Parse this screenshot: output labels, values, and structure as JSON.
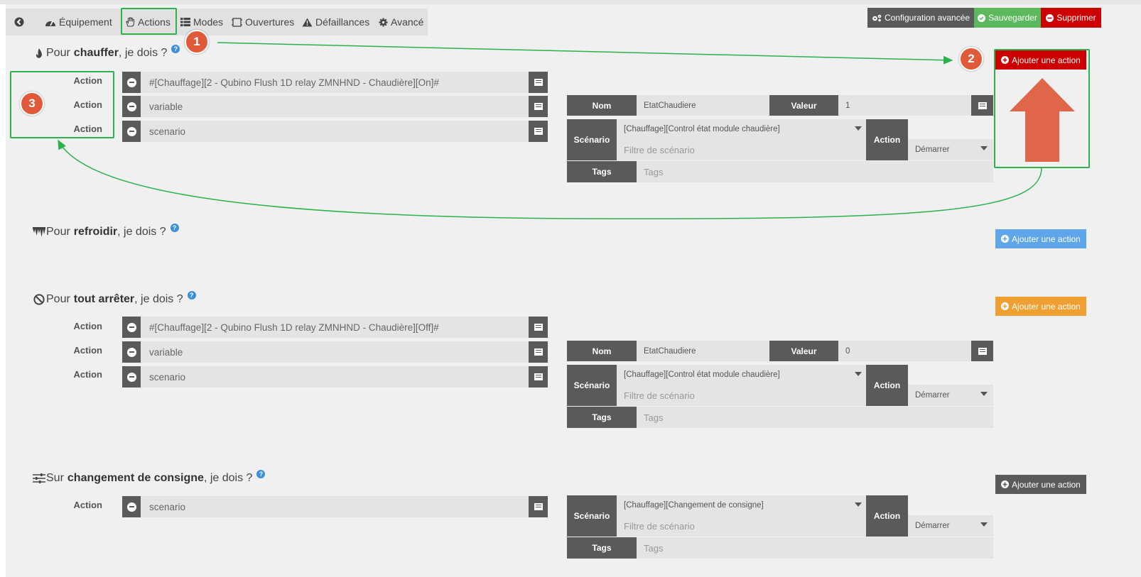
{
  "colors": {
    "dark": "#5a5a5a",
    "success": "#5cb85c",
    "danger": "#cc0000",
    "info": "#5ea5ea",
    "warning": "#f0a030",
    "annotation": "#2bb24c",
    "badge": "#e05a3a"
  },
  "tabs": [
    {
      "label": "",
      "icon": "back-arrow-icon"
    },
    {
      "label": "Équipement",
      "icon": "gauge-icon"
    },
    {
      "label": "Actions",
      "icon": "hand-icon"
    },
    {
      "label": "Modes",
      "icon": "list-icon"
    },
    {
      "label": "Ouvertures",
      "icon": "window-icon"
    },
    {
      "label": "Défaillances",
      "icon": "warning-icon"
    },
    {
      "label": "Avancé",
      "icon": "gear-icon"
    }
  ],
  "toolbar": {
    "config_label": "Configuration avancée",
    "save_label": "Sauvegarder",
    "delete_label": "Supprimer"
  },
  "badges": [
    "1",
    "2",
    "3"
  ],
  "sections": [
    {
      "prefix": "Pour",
      "bold": "chauffer",
      "suffix": ", je dois ?",
      "icon": "flame-icon",
      "add_label": "Ajouter une action",
      "actions": [
        {
          "label": "Action",
          "value": "#[Chauffage][2 - Qubino Flush 1D relay ZMNHND - Chaudière][On]#"
        },
        {
          "label": "Action",
          "value": "variable"
        },
        {
          "label": "Action",
          "value": "scenario"
        }
      ],
      "detail": {
        "nom_label": "Nom",
        "nom_value": "EtatChaudiere",
        "valeur_label": "Valeur",
        "valeur_value": "1",
        "scenario_label": "Scénario",
        "scenario_value": "[Chauffage][Control état module chaudière]",
        "scenario_filter": "Filtre de scénario",
        "action_label": "Action",
        "action_value": "Démarrer",
        "tags_label": "Tags",
        "tags_placeholder": "Tags"
      }
    },
    {
      "prefix": "Pour",
      "bold": "refroidir",
      "suffix": ", je dois ?",
      "icon": "icicle-icon",
      "add_label": "Ajouter une action"
    },
    {
      "prefix": "Pour",
      "bold": "tout arrêter",
      "suffix": ", je dois ?",
      "icon": "ban-icon",
      "add_label": "Ajouter une action",
      "actions": [
        {
          "label": "Action",
          "value": "#[Chauffage][2 - Qubino Flush 1D relay ZMNHND - Chaudière][Off]#"
        },
        {
          "label": "Action",
          "value": "variable"
        },
        {
          "label": "Action",
          "value": "scenario"
        }
      ],
      "detail": {
        "nom_label": "Nom",
        "nom_value": "EtatChaudiere",
        "valeur_label": "Valeur",
        "valeur_value": "0",
        "scenario_label": "Scénario",
        "scenario_value": "[Chauffage][Control état module chaudière]",
        "scenario_filter": "Filtre de scénario",
        "action_label": "Action",
        "action_value": "Démarrer",
        "tags_label": "Tags",
        "tags_placeholder": "Tags"
      }
    },
    {
      "prefix": "Sur",
      "bold": "changement de consigne",
      "suffix": ", je dois ?",
      "icon": "sliders-icon",
      "add_label": "Ajouter une action",
      "actions": [
        {
          "label": "Action",
          "value": "scenario"
        }
      ],
      "detail": {
        "scenario_label": "Scénario",
        "scenario_value": "[Chauffage][Changement de consigne]",
        "scenario_filter": "Filtre de scénario",
        "action_label": "Action",
        "action_value": "Démarrer",
        "tags_label": "Tags",
        "tags_placeholder": "Tags"
      }
    }
  ]
}
